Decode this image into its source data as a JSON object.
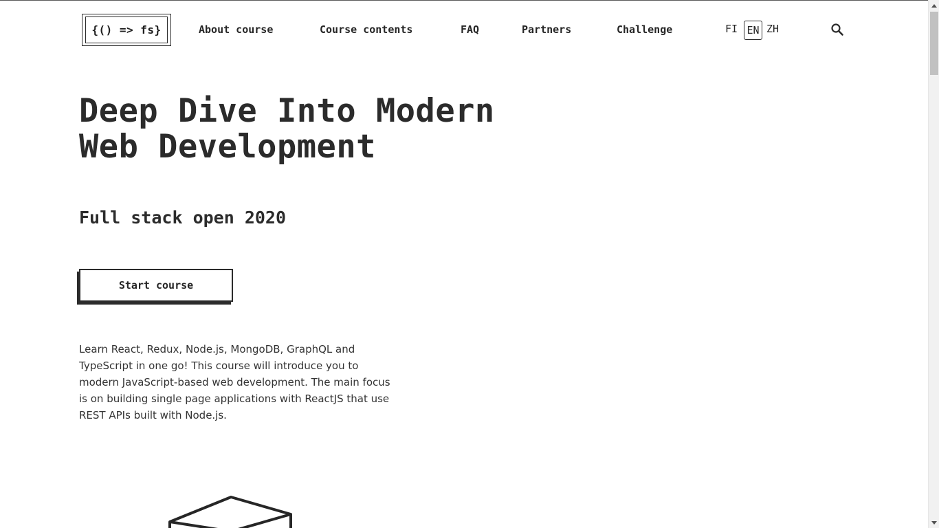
{
  "header": {
    "logo_text": "{() => fs}",
    "nav": [
      {
        "label": "About course"
      },
      {
        "label": "Course contents"
      },
      {
        "label": "FAQ"
      },
      {
        "label": "Partners"
      },
      {
        "label": "Challenge"
      }
    ],
    "languages": [
      {
        "code": "FI",
        "active": false
      },
      {
        "code": "EN",
        "active": true
      },
      {
        "code": "ZH",
        "active": false
      }
    ],
    "search_icon": "search-icon"
  },
  "hero": {
    "title_line1": "Deep Dive Into Modern",
    "title_line2": "Web Development",
    "subtitle": "Full stack open 2020",
    "cta_label": "Start course",
    "description": "Learn React, Redux, Node.js, MongoDB, GraphQL and TypeScript in one go! This course will introduce you to modern JavaScript-based web development. The main focus is on building single page applications with ReactJS that use REST APIs built with Node.js."
  },
  "colors": {
    "text": "#2b2b2b",
    "background": "#ffffff",
    "scrollbar_track": "#f1f1f1",
    "scrollbar_thumb": "#c1c1c1"
  }
}
